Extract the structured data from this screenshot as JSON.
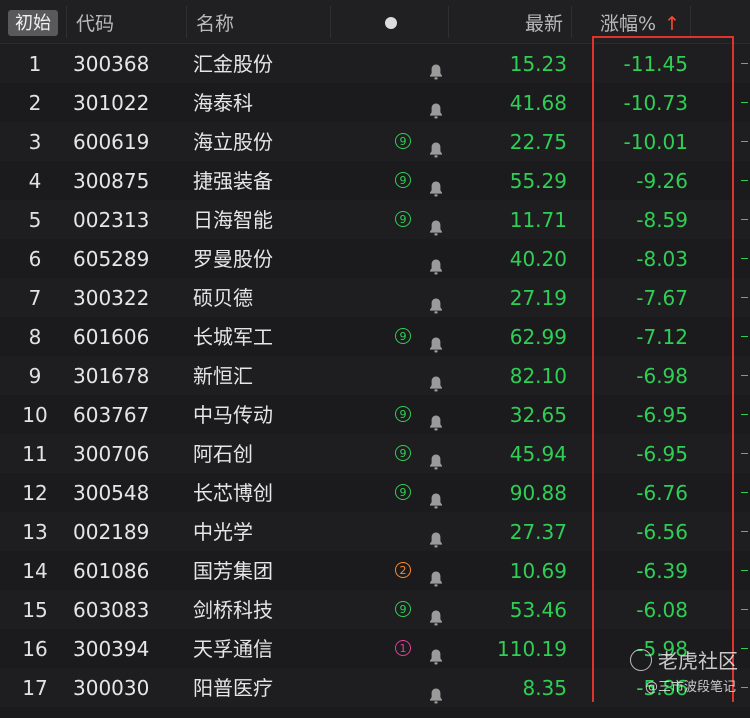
{
  "header": {
    "reset_label": "初始",
    "code_label": "代码",
    "name_label": "名称",
    "latest_label": "最新",
    "change_label": "涨幅%",
    "sort_arrow": "↑"
  },
  "colors": {
    "down": "#2fcf55",
    "highlight_box": "#e1322b",
    "badge_green": "#2fcf55",
    "badge_orange": "#ff8a2a",
    "badge_pink": "#e0409a"
  },
  "rows": [
    {
      "index": "1",
      "code": "300368",
      "name": "汇金股份",
      "badge": "",
      "price": "15.23",
      "change": "-11.45"
    },
    {
      "index": "2",
      "code": "301022",
      "name": "海泰科",
      "badge": "",
      "price": "41.68",
      "change": "-10.73"
    },
    {
      "index": "3",
      "code": "600619",
      "name": "海立股份",
      "badge": "9",
      "price": "22.75",
      "change": "-10.01"
    },
    {
      "index": "4",
      "code": "300875",
      "name": "捷强装备",
      "badge": "9",
      "price": "55.29",
      "change": "-9.26"
    },
    {
      "index": "5",
      "code": "002313",
      "name": "日海智能",
      "badge": "9",
      "price": "11.71",
      "change": "-8.59"
    },
    {
      "index": "6",
      "code": "605289",
      "name": "罗曼股份",
      "badge": "",
      "price": "40.20",
      "change": "-8.03"
    },
    {
      "index": "7",
      "code": "300322",
      "name": "硕贝德",
      "badge": "",
      "price": "27.19",
      "change": "-7.67"
    },
    {
      "index": "8",
      "code": "601606",
      "name": "长城军工",
      "badge": "9",
      "price": "62.99",
      "change": "-7.12"
    },
    {
      "index": "9",
      "code": "301678",
      "name": "新恒汇",
      "badge": "",
      "price": "82.10",
      "change": "-6.98"
    },
    {
      "index": "10",
      "code": "603767",
      "name": "中马传动",
      "badge": "9",
      "price": "32.65",
      "change": "-6.95"
    },
    {
      "index": "11",
      "code": "300706",
      "name": "阿石创",
      "badge": "9",
      "price": "45.94",
      "change": "-6.95"
    },
    {
      "index": "12",
      "code": "300548",
      "name": "长芯博创",
      "badge": "9",
      "price": "90.88",
      "change": "-6.76"
    },
    {
      "index": "13",
      "code": "002189",
      "name": "中光学",
      "badge": "",
      "price": "27.37",
      "change": "-6.56"
    },
    {
      "index": "14",
      "code": "601086",
      "name": "国芳集团",
      "badge": "2",
      "price": "10.69",
      "change": "-6.39"
    },
    {
      "index": "15",
      "code": "603083",
      "name": "剑桥科技",
      "badge": "9",
      "price": "53.46",
      "change": "-6.08"
    },
    {
      "index": "16",
      "code": "300394",
      "name": "天孚通信",
      "badge": "1",
      "price": "110.19",
      "change": "-5.98"
    },
    {
      "index": "17",
      "code": "300030",
      "name": "阳普医疗",
      "badge": "",
      "price": "8.35",
      "change": "-5.86"
    }
  ],
  "watermark": {
    "brand": "老虎社区",
    "author": "@三市波段笔记"
  }
}
